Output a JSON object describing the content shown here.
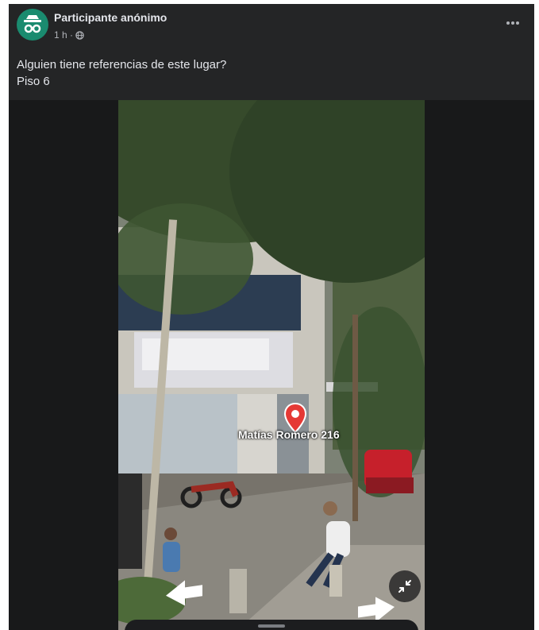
{
  "post": {
    "author": "Participante anónimo",
    "time": "1 h ·",
    "icons": {
      "avatar": "incognito-icon",
      "audience": "globe-icon",
      "more": "more-options-icon"
    },
    "text_lines": [
      "Alguien tiene referencias de este lugar?",
      "Piso 6"
    ]
  },
  "streetview": {
    "place_label": "Matías Romero 216",
    "icons": {
      "pin": "location-pin-icon",
      "collapse": "collapse-icon",
      "back": "arrow-back-icon",
      "forward": "arrow-forward-icon"
    },
    "colors": {
      "pin": "#e53935"
    }
  }
}
